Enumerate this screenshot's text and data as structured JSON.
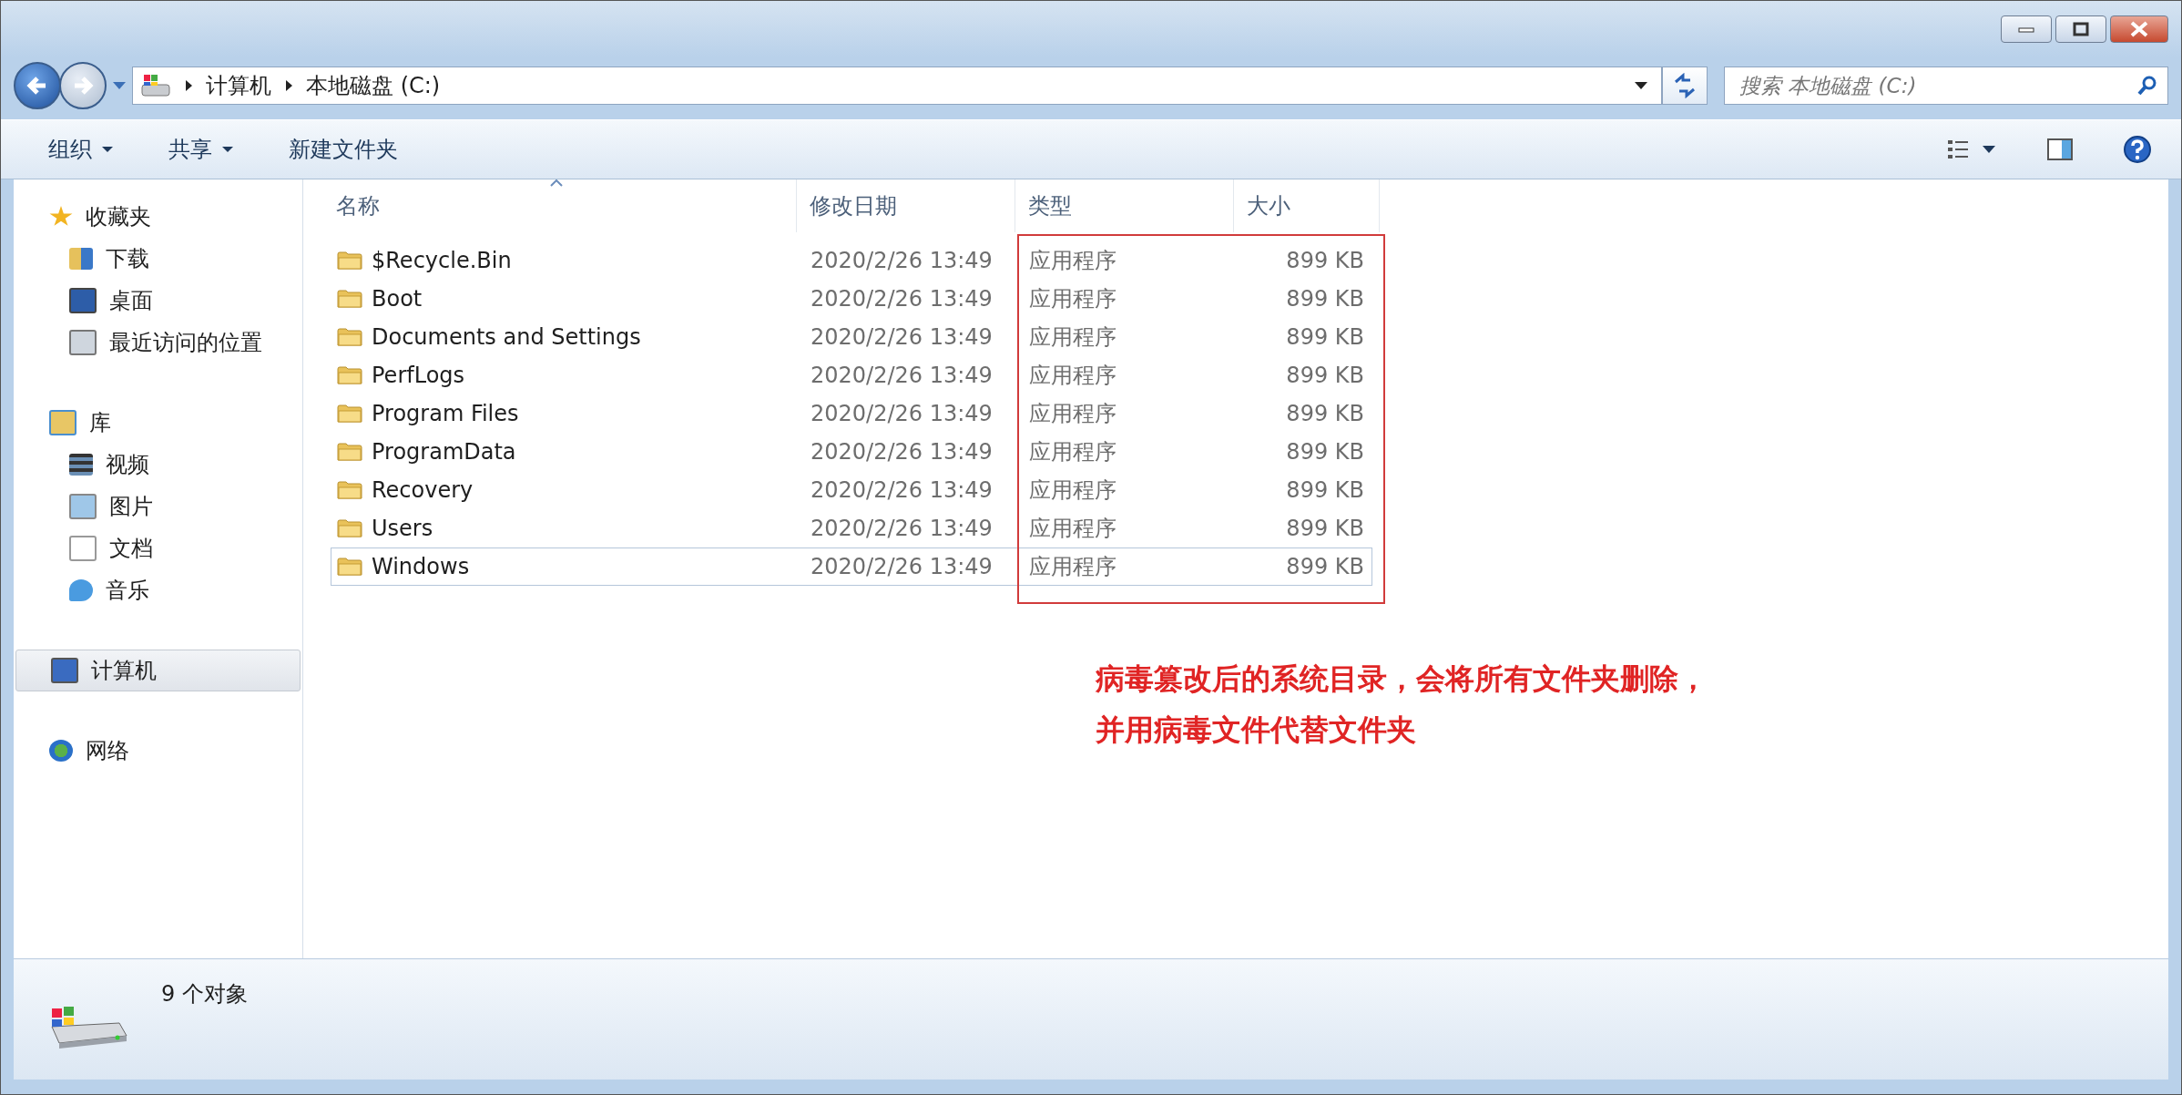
{
  "address_bar": {
    "path": [
      "计算机",
      "本地磁盘 (C:)"
    ]
  },
  "search": {
    "placeholder": "搜索 本地磁盘 (C:)"
  },
  "toolbar": {
    "items": [
      {
        "label": "组织",
        "dropdown": true
      },
      {
        "label": "共享",
        "dropdown": true
      },
      {
        "label": "新建文件夹",
        "dropdown": false
      }
    ]
  },
  "sidebar": {
    "items": [
      {
        "label": "收藏夹",
        "kind": "star",
        "selected": false,
        "children": [
          {
            "label": "下载",
            "kind": "download"
          },
          {
            "label": "桌面",
            "kind": "desktop"
          },
          {
            "label": "最近访问的位置",
            "kind": "recent"
          }
        ]
      },
      {
        "label": "库",
        "kind": "library",
        "selected": false,
        "children": [
          {
            "label": "视频",
            "kind": "video"
          },
          {
            "label": "图片",
            "kind": "picture"
          },
          {
            "label": "文档",
            "kind": "document"
          },
          {
            "label": "音乐",
            "kind": "music"
          }
        ]
      },
      {
        "label": "计算机",
        "kind": "computer",
        "selected": true
      },
      {
        "label": "网络",
        "kind": "network",
        "selected": false
      }
    ]
  },
  "table": {
    "columns": [
      {
        "label": "名称",
        "sorted": true
      },
      {
        "label": "修改日期",
        "sorted": false
      },
      {
        "label": "类型",
        "sorted": false
      },
      {
        "label": "大小",
        "sorted": false
      }
    ],
    "rows": [
      {
        "name": "$Recycle.Bin",
        "date": "2020/2/26 13:49",
        "type": "应用程序",
        "size": "899 KB",
        "focused": false
      },
      {
        "name": "Boot",
        "date": "2020/2/26 13:49",
        "type": "应用程序",
        "size": "899 KB",
        "focused": false
      },
      {
        "name": "Documents and Settings",
        "date": "2020/2/26 13:49",
        "type": "应用程序",
        "size": "899 KB",
        "focused": false
      },
      {
        "name": "PerfLogs",
        "date": "2020/2/26 13:49",
        "type": "应用程序",
        "size": "899 KB",
        "focused": false
      },
      {
        "name": "Program Files",
        "date": "2020/2/26 13:49",
        "type": "应用程序",
        "size": "899 KB",
        "focused": false
      },
      {
        "name": "ProgramData",
        "date": "2020/2/26 13:49",
        "type": "应用程序",
        "size": "899 KB",
        "focused": false
      },
      {
        "name": "Recovery",
        "date": "2020/2/26 13:49",
        "type": "应用程序",
        "size": "899 KB",
        "focused": false
      },
      {
        "name": "Users",
        "date": "2020/2/26 13:49",
        "type": "应用程序",
        "size": "899 KB",
        "focused": false
      },
      {
        "name": "Windows",
        "date": "2020/2/26 13:49",
        "type": "应用程序",
        "size": "899 KB",
        "focused": true
      }
    ]
  },
  "annotation": {
    "lines": [
      "病毒篡改后的系统目录，会将所有文件夹删除，",
      "并用病毒文件代替文件夹"
    ]
  },
  "status_bar": {
    "text": "9 个对象"
  }
}
